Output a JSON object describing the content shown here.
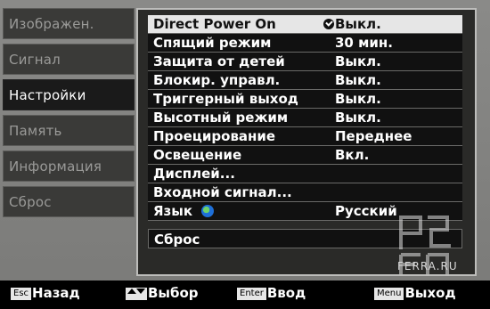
{
  "side_menu": {
    "items": [
      {
        "label": "Изображен."
      },
      {
        "label": "Сигнал"
      },
      {
        "label": "Настройки"
      },
      {
        "label": "Память"
      },
      {
        "label": "Информация"
      },
      {
        "label": "Сброс"
      }
    ]
  },
  "panel": {
    "rows": [
      {
        "label": "Direct Power On",
        "value": "Выкл."
      },
      {
        "label": "Спящий режим",
        "value": "30 мин."
      },
      {
        "label": "Защита от детей",
        "value": "Выкл."
      },
      {
        "label": "Блокир. управл.",
        "value": "Выкл."
      },
      {
        "label": "Триггерный выход",
        "value": "Выкл."
      },
      {
        "label": "Высотный режим",
        "value": "Выкл."
      },
      {
        "label": "Проецирование",
        "value": "Переднее"
      },
      {
        "label": "Освещение",
        "value": "Вкл."
      },
      {
        "label": "Дисплей...",
        "value": ""
      },
      {
        "label": "Входной сигнал...",
        "value": ""
      },
      {
        "label": "Язык",
        "value": "Русский"
      }
    ],
    "reset_label": "Сброс"
  },
  "watermark": {
    "text": "FERRA.RU"
  },
  "bottom_bar": {
    "esc_key": "Esc",
    "esc_label": "Назад",
    "select_label": "Выбор",
    "enter_key": "Enter",
    "enter_label": "Ввод",
    "menu_key": "Menu",
    "menu_label": "Выход"
  }
}
